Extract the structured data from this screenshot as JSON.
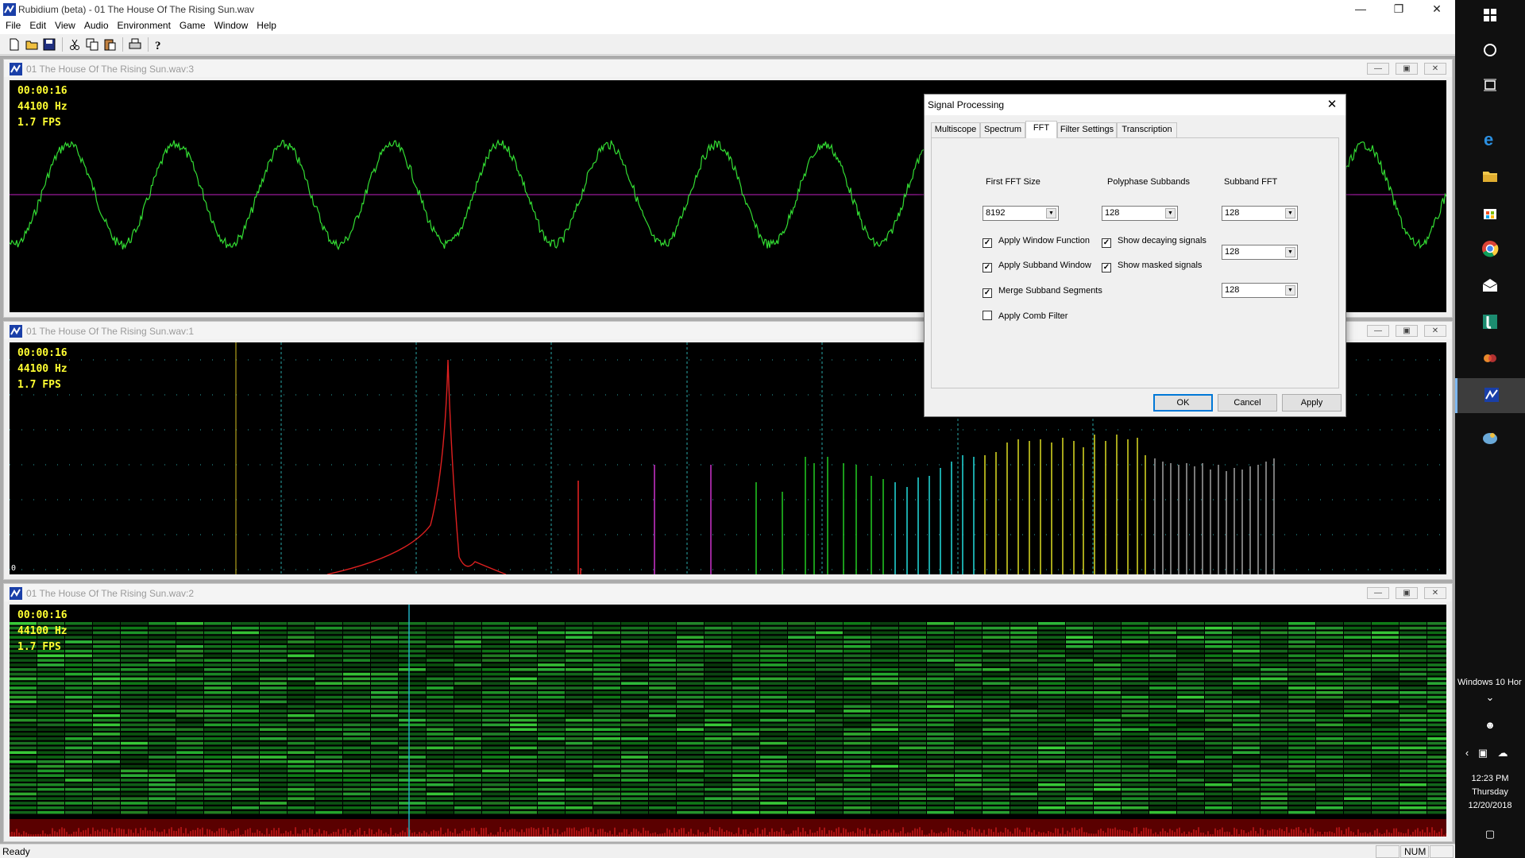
{
  "app": {
    "title": "Rubidium (beta) - 01 The House Of The Rising Sun.wav"
  },
  "menu": [
    "File",
    "Edit",
    "View",
    "Audio",
    "Environment",
    "Game",
    "Window",
    "Help"
  ],
  "toolbar": [
    "new-file-icon",
    "open-folder-icon",
    "save-icon",
    "cut-icon",
    "copy-icon",
    "paste-icon",
    "print-icon",
    "help-icon"
  ],
  "windows": [
    {
      "name": "01 The House Of The Rising Sun.wav:3",
      "kind": "oscilloscope",
      "time": "00:00:16",
      "rate": "44100 Hz",
      "fps": "1.7 FPS"
    },
    {
      "name": "01 The House Of The Rising Sun.wav:1",
      "kind": "spectrum",
      "time": "00:00:16",
      "rate": "44100 Hz",
      "fps": "1.7 FPS",
      "zero": "0"
    },
    {
      "name": "01 The House Of The Rising Sun.wav:2",
      "kind": "spectrogram",
      "time": "00:00:16",
      "rate": "44100 Hz",
      "fps": "1.7 FPS"
    }
  ],
  "dialog": {
    "title": "Signal Processing",
    "tabs": [
      "Multiscope",
      "Spectrum",
      "FFT",
      "Filter Settings",
      "Transcription"
    ],
    "active_tab": "FFT",
    "headers": {
      "first_fft": "First FFT Size",
      "polyphase": "Polyphase Subbands",
      "subband_fft": "Subband FFT"
    },
    "combos": {
      "first_fft": "8192",
      "polyphase": "128",
      "subband_fft": "128",
      "subband_fft_2": "128",
      "subband_fft_3": "128"
    },
    "checks": [
      {
        "label": "Apply Window Function",
        "checked": true
      },
      {
        "label": "Apply Subband Window",
        "checked": true
      },
      {
        "label": "Merge Subband Segments",
        "checked": true
      },
      {
        "label": "Apply Comb Filter",
        "checked": false
      },
      {
        "label": "Show decaying signals",
        "checked": true
      },
      {
        "label": "Show masked signals",
        "checked": true
      }
    ],
    "buttons": {
      "ok": "OK",
      "cancel": "Cancel",
      "apply": "Apply"
    }
  },
  "status": {
    "text": "Ready",
    "num": "NUM"
  },
  "taskbar": {
    "icons": [
      "windows-start-icon",
      "cortana-icon",
      "task-view-icon",
      "edge-icon",
      "file-explorer-icon",
      "store-icon",
      "chrome-icon",
      "mail-icon",
      "app-icon",
      "app-icon",
      "rubidium-icon",
      "app-icon"
    ],
    "system_label": "Windows 10 Hor",
    "time": "12:23 PM",
    "day": "Thursday",
    "date": "12/20/2018"
  },
  "colors": {
    "scope_text": "#ffff32",
    "waveform": "#33dd33",
    "accent": "#0078d7"
  }
}
